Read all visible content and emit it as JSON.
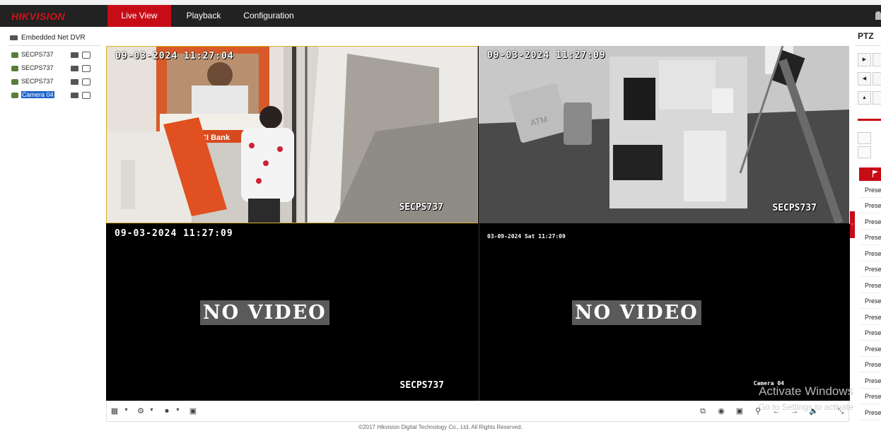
{
  "header": {
    "logo": "HIKVISION",
    "tabs": [
      {
        "label": "Live View",
        "active": true
      },
      {
        "label": "Playback"
      },
      {
        "label": "Configuration"
      }
    ]
  },
  "sidebar": {
    "device": "Embedded Net DVR",
    "cameras": [
      {
        "label": "SECPS737"
      },
      {
        "label": "SECPS737"
      },
      {
        "label": "SECPS737"
      },
      {
        "label": "Camera 04",
        "selected": true
      }
    ]
  },
  "tiles": [
    {
      "timestamp": "09-03-2024 11:27:04",
      "name": "SECPS737"
    },
    {
      "timestamp": "09-03-2024 11:27:09",
      "name": "SECPS737"
    },
    {
      "timestamp": "09-03-2024 11:27:09",
      "name": "SECPS737",
      "status": "NO VIDEO"
    },
    {
      "timestamp": "03-09-2024 Sat 11:27:09",
      "name": "Camera 04",
      "status": "NO VIDEO"
    }
  ],
  "scene": {
    "bank_sign": "ICI Bank",
    "atm_label": "ATM"
  },
  "ptz": {
    "title": "PTZ",
    "presets": [
      "Prese",
      "Prese",
      "Prese",
      "Prese",
      "Prese",
      "Prese",
      "Prese",
      "Prese",
      "Prese",
      "Prese",
      "Prese",
      "Prese",
      "Prese",
      "Prese",
      "Prese"
    ]
  },
  "footer": "©2017 Hikvision Digital Technology Co., Ltd. All Rights Reserved.",
  "watermark": {
    "title": "Activate Windows",
    "subtitle": "Go to Settings to activate"
  },
  "colors": {
    "brand_red": "#c80c17",
    "header_bg": "#222222",
    "selection_border": "#e0b020"
  }
}
